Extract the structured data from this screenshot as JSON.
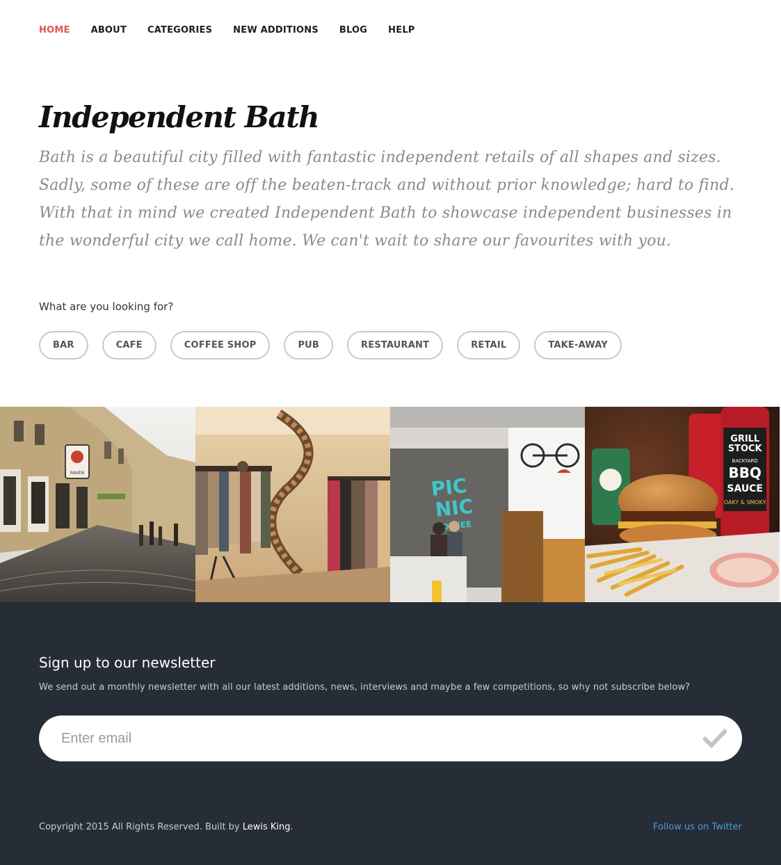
{
  "nav": {
    "items": [
      {
        "label": "HOME"
      },
      {
        "label": "ABOUT"
      },
      {
        "label": "CATEGORIES"
      },
      {
        "label": "NEW ADDITIONS"
      },
      {
        "label": "BLOG"
      },
      {
        "label": "HELP"
      }
    ],
    "active_color": "#e2574c"
  },
  "hero": {
    "title": "Independent Bath",
    "text": "Bath is a beautiful city filled with fantastic independent retails of all shapes and sizes. Sadly, some of these are off the beaten-track and without prior knowledge; hard to find. With that in mind we created Independent Bath to showcase independent businesses in the wonderful city we call home. We can't wait to share our favourites with you."
  },
  "filter": {
    "label": "What are you looking for?",
    "options": [
      {
        "label": "BAR"
      },
      {
        "label": "CAFE"
      },
      {
        "label": "COFFEE SHOP"
      },
      {
        "label": "PUB"
      },
      {
        "label": "RESTAURANT"
      },
      {
        "label": "RETAIL"
      },
      {
        "label": "TAKE-AWAY"
      }
    ]
  },
  "gallery": {
    "sign_text": "RAVEN",
    "cafe_sign": [
      "PIC",
      "NIC",
      "COFFEE"
    ],
    "sauce_label": [
      "GRILL",
      "STOCK",
      "BACKYARD",
      "BBQ",
      "SAUCE",
      "OAKY & SMOKY"
    ]
  },
  "newsletter": {
    "title": "Sign up to our newsletter",
    "text": "We send out a monthly newsletter with all our latest additions, news, interviews and maybe a few competitions, so why not subscribe below?",
    "placeholder": "Enter email",
    "submit_icon": "checkmark-icon"
  },
  "footer": {
    "copyright_prefix": "Copyright 2015 All Rights Reserved. Built by ",
    "author": "Lewis King",
    "copyright_suffix": ".",
    "twitter_label": "Follow us on Twitter",
    "background": "#262d37",
    "link_color": "#4a9bd6"
  }
}
